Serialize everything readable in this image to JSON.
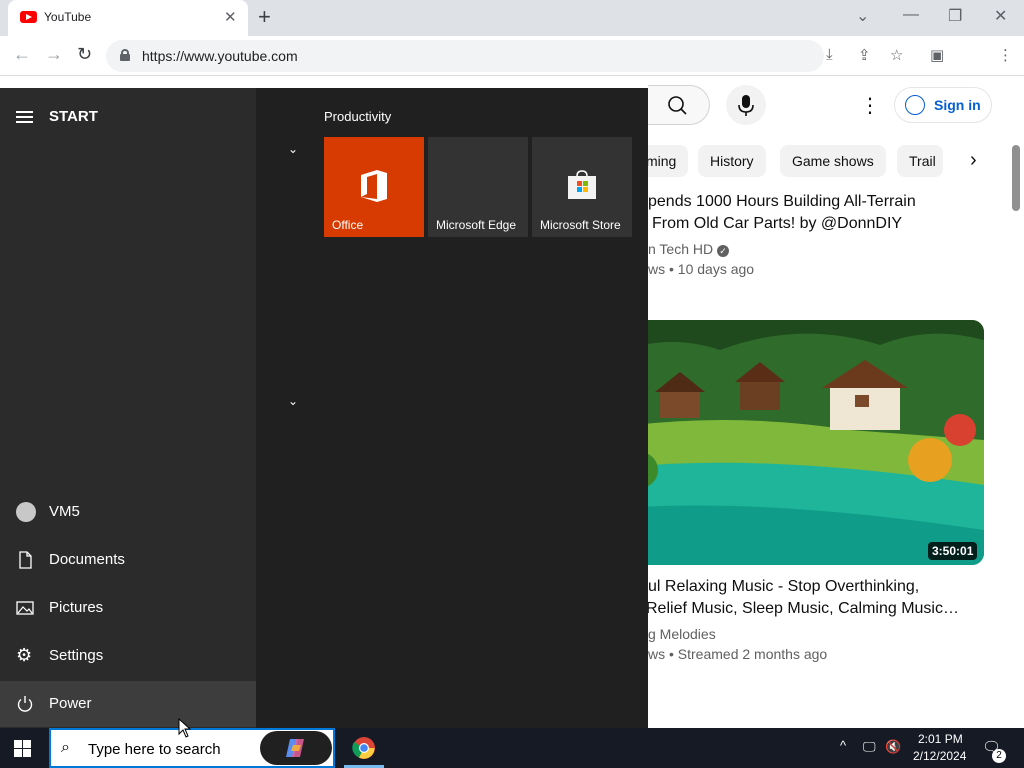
{
  "browser": {
    "tab_title": "YouTube",
    "url": "https://www.youtube.com",
    "new_tab_label": "+",
    "close_tab_label": "✕"
  },
  "youtube": {
    "sign_in_label": "Sign in",
    "chips": [
      "ming",
      "History",
      "Game shows",
      "Trail"
    ],
    "video1": {
      "title_line1": "pends 1000 Hours Building All-Terrain",
      "title_line2": "From Old Car Parts! by @DonnDIY",
      "channel": "n Tech HD",
      "meta": "ws • 10 days ago"
    },
    "video2": {
      "duration": "3:50:01",
      "title_line1": "ul Relaxing Music - Stop Overthinking,",
      "title_line2": "Relief Music, Sleep Music, Calming Music…",
      "channel": "g Melodies",
      "meta": "ws • Streamed 2 months ago"
    }
  },
  "start_menu": {
    "title": "START",
    "group_title": "Productivity",
    "left_items": [
      {
        "label": "VM5",
        "icon": "user-icon"
      },
      {
        "label": "Documents",
        "icon": "document-icon"
      },
      {
        "label": "Pictures",
        "icon": "pictures-icon"
      },
      {
        "label": "Settings",
        "icon": "gear-icon"
      },
      {
        "label": "Power",
        "icon": "power-icon"
      }
    ],
    "tiles": [
      {
        "label": "Office",
        "color": "#d83b01"
      },
      {
        "label": "Microsoft Edge",
        "color": "#333333"
      },
      {
        "label": "Microsoft Store",
        "color": "#333333"
      }
    ]
  },
  "taskbar": {
    "search_placeholder": "Type here to search",
    "time": "2:01 PM",
    "date": "2/12/2024",
    "notification_count": "2"
  },
  "colors": {
    "accent": "#0078d7",
    "youtube_red": "#ff0000",
    "office_orange": "#d83b01",
    "start_bg": "#202020",
    "link_blue": "#065fd4"
  }
}
